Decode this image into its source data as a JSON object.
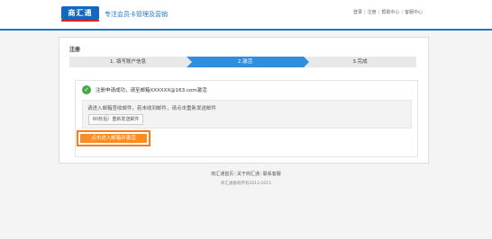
{
  "header": {
    "logo_text": "商汇通",
    "slogan": "专注会员卡管理及营销",
    "links": [
      "登录",
      "注册",
      "帮助中心",
      "客服中心"
    ],
    "separator": "|",
    "accent_color": "#1e78c8"
  },
  "main": {
    "title": "注册",
    "steps": [
      {
        "label": "1. 填写账户信息",
        "active": false
      },
      {
        "label": "2.激活",
        "active": true
      },
      {
        "label": "3.完成",
        "active": false
      }
    ],
    "success_message": "注册申请成功，请至邮箱XXXXXX@163.com激活",
    "notice_text": "请进入邮箱查收邮件，若未收到邮件，请点击重新发送邮件",
    "resend_button": "60秒后）重新发送邮件",
    "activate_button": "点击进入邮箱并激活",
    "success_icon": "check-circle-icon",
    "highlight_color": "#ff7a1a"
  },
  "footer": {
    "links": [
      "商汇通首页",
      "关于商汇通",
      "联系客服"
    ],
    "separator": "|",
    "copyright": "商汇通版权所有2012-2015"
  }
}
